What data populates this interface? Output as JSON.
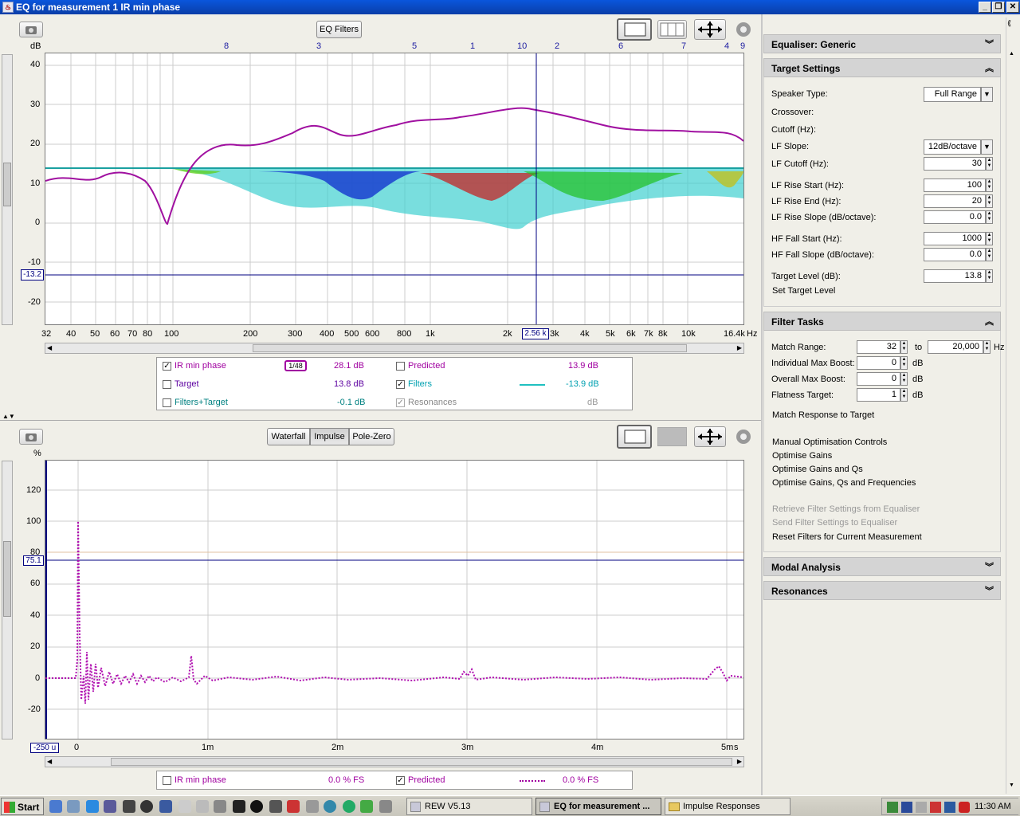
{
  "window": {
    "title": "EQ for measurement 1 IR min phase",
    "controls": [
      "_",
      "❐",
      "✕"
    ]
  },
  "top": {
    "eq_filters_btn": "EQ Filters",
    "y_unit": "dB",
    "y_ticks": [
      "40",
      "30",
      "20",
      "10",
      "0",
      "-10",
      "-20"
    ],
    "x_ticks": [
      "32",
      "40",
      "50",
      "60",
      "70",
      "80",
      "100",
      "200",
      "300",
      "400",
      "500",
      "600",
      "800",
      "1k",
      "2k",
      "3k",
      "4k",
      "5k",
      "6k",
      "7k",
      "8k",
      "10k",
      "16.4k"
    ],
    "x_unit": "Hz",
    "cursor_x": "2.56 k",
    "cursor_y": "-13.2",
    "filter_numbers": [
      "8",
      "3",
      "5",
      "1",
      "10",
      "2",
      "6",
      "7",
      "4",
      "9"
    ],
    "legend": [
      {
        "label": "IR min phase",
        "checked": true,
        "value": "28.1 dB",
        "color": "#a000a0",
        "smooth": "1/48"
      },
      {
        "label": "Target",
        "checked": false,
        "value": "13.8 dB",
        "color": "#5c00a0"
      },
      {
        "label": "Filters+Target",
        "checked": false,
        "value": "-0.1 dB",
        "color": "#008080"
      },
      {
        "label": "Predicted",
        "checked": false,
        "value": "13.9 dB",
        "color": "#a000a0"
      },
      {
        "label": "Filters",
        "checked": true,
        "value": "-13.9 dB",
        "color": "#00a0b0"
      },
      {
        "label": "Resonances",
        "checked": true,
        "value": "dB",
        "color": "#888888"
      }
    ]
  },
  "bottom": {
    "tabs": [
      "Waterfall",
      "Impulse",
      "Pole-Zero"
    ],
    "active_tab": "Impulse",
    "y_unit": "%",
    "y_ticks": [
      "120",
      "100",
      "80",
      "60",
      "40",
      "20",
      "0",
      "-20"
    ],
    "x_ticks": [
      "0",
      "1m",
      "2m",
      "3m",
      "4m",
      "5m"
    ],
    "x_unit": "s",
    "cursor_x": "-250 u",
    "cursor_y": "75.1",
    "legend": [
      {
        "label": "IR min phase",
        "checked": false,
        "value": "0.0 % FS"
      },
      {
        "label": "Predicted",
        "checked": true,
        "value": "0.0 % FS"
      }
    ]
  },
  "side": {
    "equaliser": "Equaliser: Generic",
    "target_settings": "Target Settings",
    "speaker_type_label": "Speaker Type:",
    "speaker_type": "Full Range",
    "crossover": "Crossover:",
    "cutoff": "Cutoff (Hz):",
    "lf_slope_label": "LF Slope:",
    "lf_slope": "12dB/octave",
    "rows": [
      {
        "label": "LF Cutoff (Hz):",
        "value": "30"
      },
      {
        "label": "LF Rise Start (Hz):",
        "value": "100"
      },
      {
        "label": "LF Rise End (Hz):",
        "value": "20"
      },
      {
        "label": "LF Rise Slope (dB/octave):",
        "value": "0.0"
      },
      {
        "label": "HF Fall Start (Hz):",
        "value": "1000"
      },
      {
        "label": "HF Fall Slope (dB/octave):",
        "value": "0.0"
      },
      {
        "label": "Target Level (dB):",
        "value": "13.8"
      }
    ],
    "set_target": "Set Target Level",
    "filter_tasks": "Filter Tasks",
    "match_range_label": "Match Range:",
    "match_from": "32",
    "to": "to",
    "match_to": "20,000",
    "hz": "Hz",
    "db": "dB",
    "indiv_label": "Individual Max Boost:",
    "indiv": "0",
    "overall_label": "Overall Max Boost:",
    "overall": "0",
    "flat_label": "Flatness Target:",
    "flat": "1",
    "match_response": "Match Response to Target",
    "manual": "Manual Optimisation Controls",
    "opt1": "Optimise Gains",
    "opt2": "Optimise Gains and Qs",
    "opt3": "Optimise Gains, Qs and Frequencies",
    "retrieve": "Retrieve Filter Settings from Equaliser",
    "send": "Send Filter Settings to Equaliser",
    "reset": "Reset Filters for Current Measurement",
    "modal": "Modal Analysis",
    "resonances": "Resonances"
  },
  "taskbar": {
    "start": "Start",
    "tasks": [
      "REW V5.13",
      "EQ for measurement ...",
      "Impulse Responses"
    ],
    "clock": "11:30 AM"
  }
}
